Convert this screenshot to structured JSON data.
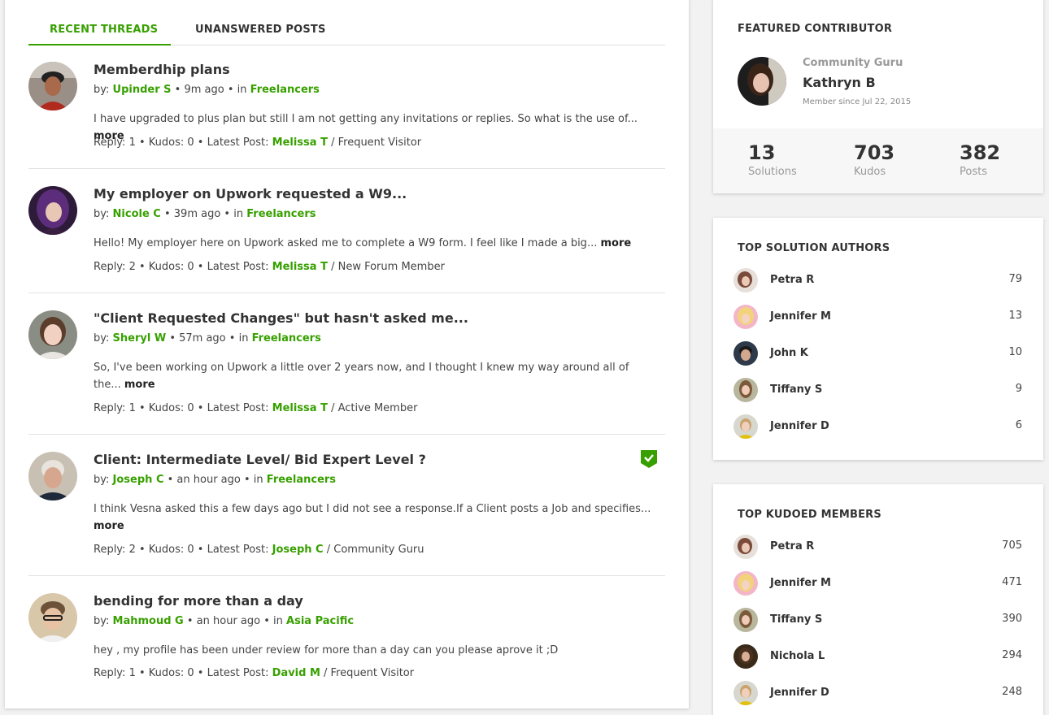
{
  "tabs": [
    {
      "label": "RECENT THREADS"
    },
    {
      "label": "UNANSWERED POSTS"
    }
  ],
  "colors": {
    "accent": "#37a000",
    "panel": "#ffffff",
    "background": "#f2f2f2"
  },
  "threads": [
    {
      "title": "Memberdhip plans",
      "by_label": "by:",
      "author": "Upinder S",
      "time": "9m ago",
      "in_label": "in",
      "board": "Freelancers",
      "excerpt": "I have upgraded to plus plan but still I am not getting any invitations or replies. So what is the use of...",
      "more": "more",
      "replies": "Reply: 1",
      "kudos": "Kudos: 0",
      "latest_label": "Latest Post:",
      "latest_author": "Melissa T",
      "latest_rank": "/ Frequent Visitor",
      "solved": false
    },
    {
      "title": "My employer on Upwork requested a W9...",
      "by_label": "by:",
      "author": "Nicole C",
      "time": "39m ago",
      "in_label": "in",
      "board": "Freelancers",
      "excerpt": "Hello!  My employer here on Upwork asked me to complete a W9 form. I feel like I made a big...",
      "more": "more",
      "replies": "Reply: 2",
      "kudos": "Kudos: 0",
      "latest_label": "Latest Post:",
      "latest_author": "Melissa T",
      "latest_rank": "/ New Forum Member",
      "solved": false
    },
    {
      "title": "\"Client Requested Changes\" but hasn't asked me...",
      "by_label": "by:",
      "author": "Sheryl W",
      "time": "57m ago",
      "in_label": "in",
      "board": "Freelancers",
      "excerpt": "So, I've been working on Upwork a little over 2 years now, and I thought I knew my way around all of the...",
      "more": "more",
      "replies": "Reply: 1",
      "kudos": "Kudos: 0",
      "latest_label": "Latest Post:",
      "latest_author": "Melissa T",
      "latest_rank": "/ Active Member",
      "solved": false
    },
    {
      "title": "Client: Intermediate Level/ Bid Expert Level ?",
      "by_label": "by:",
      "author": "Joseph C",
      "time": "an hour ago",
      "in_label": "in",
      "board": "Freelancers",
      "excerpt": "I think Vesna asked this a few days ago but I did not see a response.If a Client posts a Job and specifies...",
      "more": "more",
      "replies": "Reply: 2",
      "kudos": "Kudos: 0",
      "latest_label": "Latest Post:",
      "latest_author": "Joseph C",
      "latest_rank": "/ Community Guru",
      "solved": true
    },
    {
      "title": "bending for more than a day",
      "by_label": "by:",
      "author": "Mahmoud G",
      "time": "an hour ago",
      "in_label": "in",
      "board": "Asia Pacific",
      "excerpt": "hey , my profile has been under review for more than a day can you please aprove it ;D",
      "more": "",
      "replies": "Reply: 1",
      "kudos": "Kudos: 0",
      "latest_label": "Latest Post:",
      "latest_author": "David M",
      "latest_rank": "/ Frequent Visitor",
      "solved": false
    }
  ],
  "featured": {
    "title": "FEATURED CONTRIBUTOR",
    "rank": "Community Guru",
    "name": "Kathryn B",
    "since": "Member since Jul 22, 2015",
    "stats": [
      {
        "num": "13",
        "label": "Solutions"
      },
      {
        "num": "703",
        "label": "Kudos"
      },
      {
        "num": "382",
        "label": "Posts"
      }
    ]
  },
  "solution_authors": {
    "title": "TOP SOLUTION AUTHORS",
    "items": [
      {
        "name": "Petra R",
        "value": "79"
      },
      {
        "name": "Jennifer M",
        "value": "13"
      },
      {
        "name": "John K",
        "value": "10"
      },
      {
        "name": "Tiffany S",
        "value": "9"
      },
      {
        "name": "Jennifer D",
        "value": "6"
      }
    ]
  },
  "kudoed_members": {
    "title": "TOP KUDOED MEMBERS",
    "items": [
      {
        "name": "Petra R",
        "value": "705"
      },
      {
        "name": "Jennifer M",
        "value": "471"
      },
      {
        "name": "Tiffany S",
        "value": "390"
      },
      {
        "name": "Nichola L",
        "value": "294"
      },
      {
        "name": "Jennifer D",
        "value": "248"
      }
    ]
  }
}
